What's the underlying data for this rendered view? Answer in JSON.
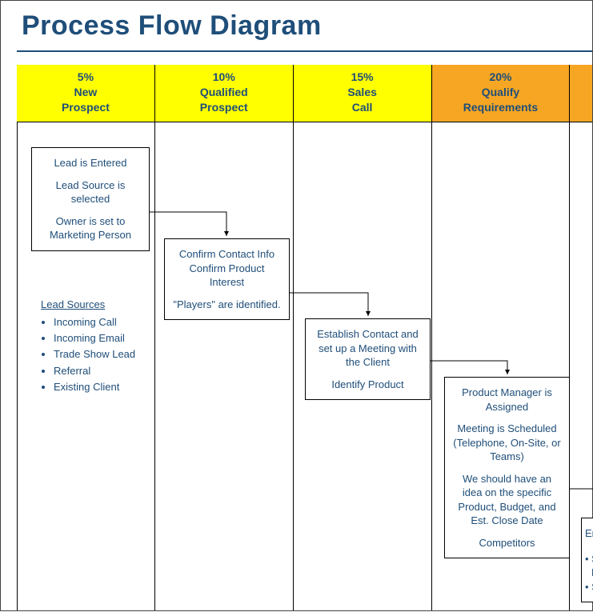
{
  "title": "Process Flow Diagram",
  "columns": [
    {
      "percent": "5%",
      "label1": "New",
      "label2": "Prospect",
      "color": "yellow"
    },
    {
      "percent": "10%",
      "label1": "Qualified",
      "label2": "Prospect",
      "color": "yellow"
    },
    {
      "percent": "15%",
      "label1": "Sales",
      "label2": "Call",
      "color": "yellow"
    },
    {
      "percent": "20%",
      "label1": "Qualify",
      "label2": "Requirements",
      "color": "orange"
    }
  ],
  "box1": {
    "p1": "Lead is Entered",
    "p2": "Lead Source is selected",
    "p3": "Owner is set to Marketing Person"
  },
  "box2": {
    "p1": "Confirm Contact Info Confirm Product Interest",
    "p2": "\"Players\" are identified."
  },
  "box3": {
    "p1": "Establish Contact and set up a Meeting with the Client",
    "p2": "Identify Product"
  },
  "box4": {
    "p1": "Product Manager is Assigned",
    "p2": "Meeting is Scheduled (Telephone, On-Site, or Teams)",
    "p3": "We should have an idea on the specific Product, Budget, and Est. Close Date",
    "p4": "Competitors"
  },
  "box5": {
    "p1a": "Eng",
    "p2a": "S",
    "p2b": "P",
    "p3a": "S"
  },
  "lead_sources": {
    "title": "Lead Sources",
    "items": [
      "Incoming Call",
      "Incoming Email",
      "Trade Show Lead",
      "Referral",
      "Existing Client"
    ]
  }
}
